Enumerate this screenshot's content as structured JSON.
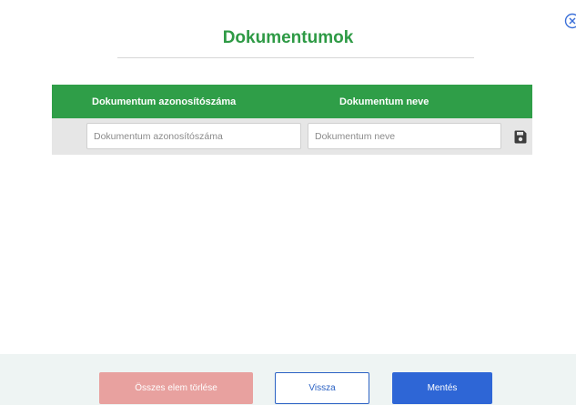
{
  "dialog": {
    "title": "Dokumentumok"
  },
  "icons": {
    "close": "close-circle-icon",
    "save_row": "floppy-disk-icon"
  },
  "table": {
    "columns": [
      "Dokumentum azonosítószáma",
      "Dokumentum neve"
    ],
    "new_row": {
      "id_value": "",
      "id_placeholder": "Dokumentum azonosítószáma",
      "name_value": "",
      "name_placeholder": "Dokumentum neve"
    }
  },
  "footer": {
    "clear_all_label": "Összes elem törlése",
    "back_label": "Vissza",
    "save_label": "Mentés"
  },
  "colors": {
    "accent_green": "#2f9e48",
    "primary_blue": "#2e66d6",
    "danger_light": "#e8a19f"
  }
}
